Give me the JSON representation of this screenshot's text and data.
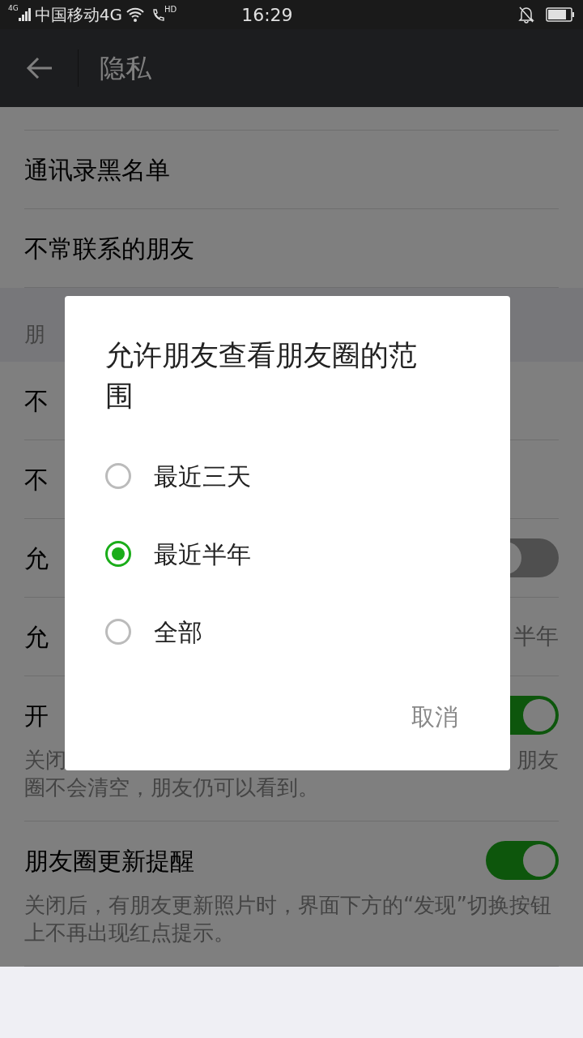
{
  "status_bar": {
    "network_badge": "4G",
    "carrier": "中国移动4G",
    "call_badge": "HD",
    "time": "16:29"
  },
  "toolbar": {
    "title": "隐私"
  },
  "list": [
    {
      "kind": "nav",
      "label": "通讯录黑名单"
    },
    {
      "kind": "nav",
      "label": "不常联系的朋友"
    },
    {
      "kind": "header",
      "label": "朋"
    },
    {
      "kind": "nav",
      "label": "不"
    },
    {
      "kind": "nav",
      "label": "不"
    },
    {
      "kind": "toggle",
      "label": "允",
      "on": false
    },
    {
      "kind": "value",
      "label": "允",
      "value": "半年"
    },
    {
      "kind": "toggle",
      "label": "开",
      "on": true,
      "desc_start": "关闭",
      "desc_end": "朋友",
      "desc_rest": "圈不会清空，朋友仍可以看到。"
    },
    {
      "kind": "toggle",
      "label": "朋友圈更新提醒",
      "on": true,
      "desc_rest": "关闭后，有朋友更新照片时，界面下方的“发现”切换按钮上不再出现红点提示。"
    }
  ],
  "dialog": {
    "title": "允许朋友查看朋友圈的范围",
    "options": [
      {
        "label": "最近三天",
        "selected": false
      },
      {
        "label": "最近半年",
        "selected": true
      },
      {
        "label": "全部",
        "selected": false
      }
    ],
    "cancel": "取消"
  }
}
